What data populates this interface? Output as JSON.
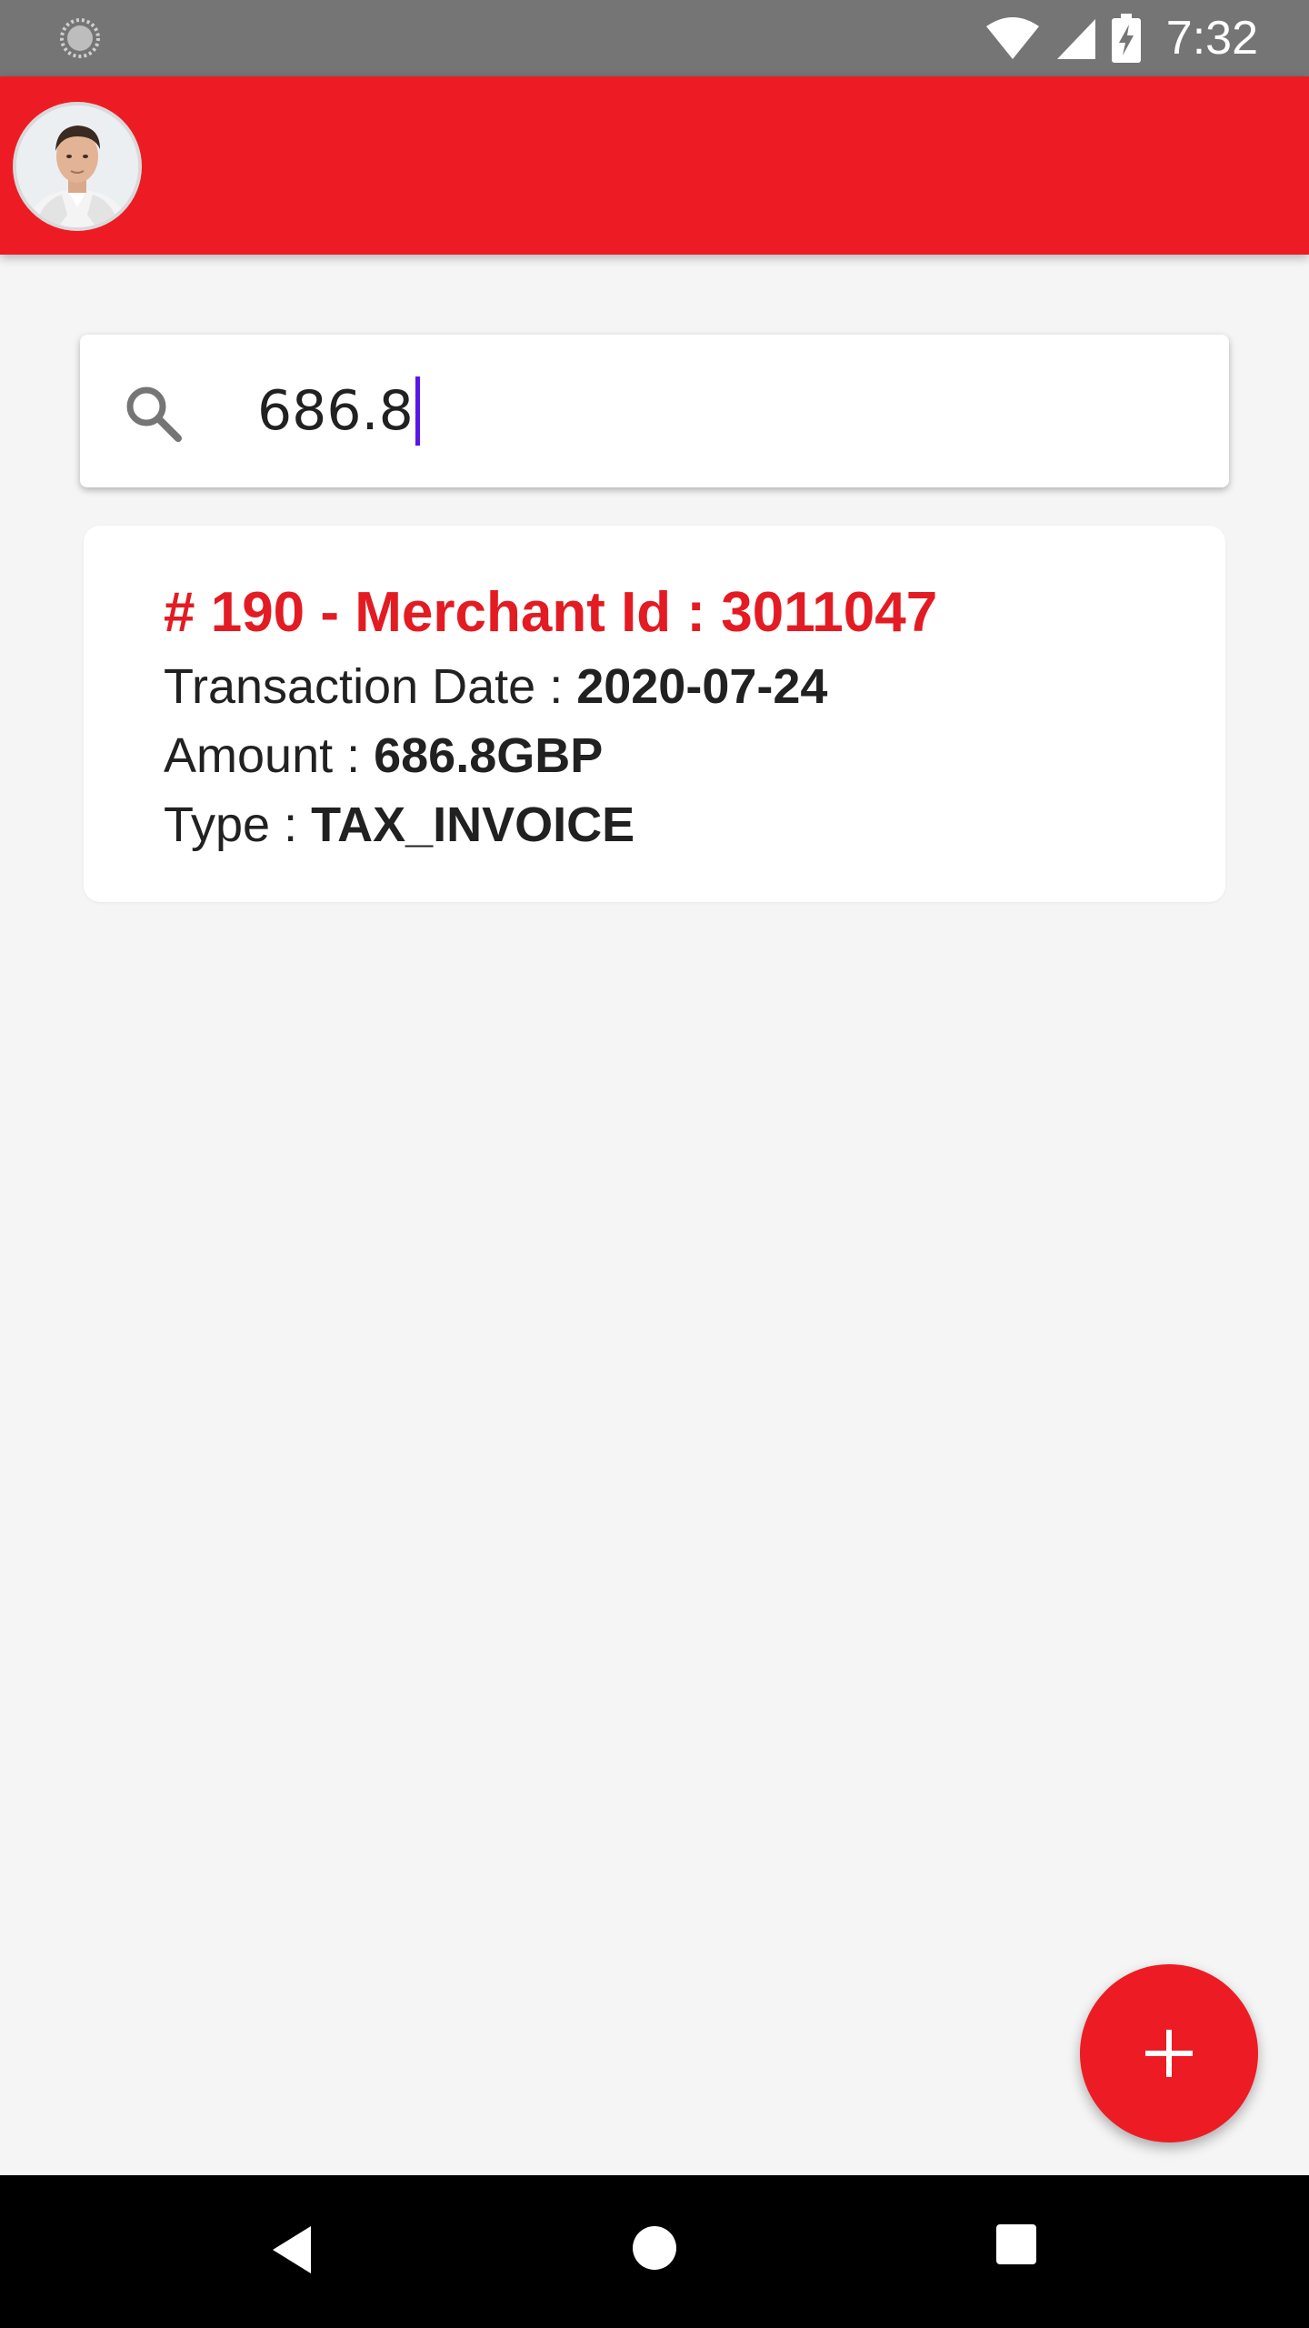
{
  "status_bar": {
    "time": "7:32",
    "left_icon": "loading-spinner-icon",
    "icons": [
      "wifi-icon",
      "signal-icon",
      "battery-charging-icon"
    ]
  },
  "app_bar": {
    "avatar": "user-avatar",
    "color": "#ed1c24"
  },
  "search": {
    "icon": "search-icon",
    "value": "686.8"
  },
  "results": [
    {
      "title": "# 190 - Merchant Id : 3011047",
      "date_label": "Transaction Date : ",
      "date_value": "2020-07-24",
      "amount_label": "Amount : ",
      "amount_value": "686.8GBP",
      "type_label": "Type : ",
      "type_value": "TAX_INVOICE"
    }
  ],
  "fab": {
    "icon": "plus-icon",
    "color": "#ed1c24"
  },
  "nav_bar": {
    "icons": [
      "back-icon",
      "home-icon",
      "recents-icon"
    ]
  },
  "colors": {
    "accent": "#ed1c24",
    "title_red": "#e31b23",
    "cursor": "#5b16e6",
    "background": "#f5f5f5"
  }
}
